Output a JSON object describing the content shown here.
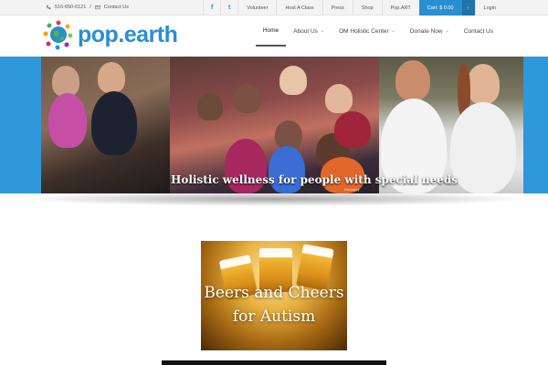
{
  "topbar": {
    "phone": "516-650-6121",
    "separator": "/",
    "contact_label": "Contact Us",
    "facebook": "f",
    "twitter": "t",
    "links": [
      "Volunteer",
      "Host A Class",
      "Press",
      "Shop",
      "Pop.ART"
    ],
    "cart_label": "Cart: $ 0.00",
    "cart_arrow": "›",
    "login_label": "Login"
  },
  "header": {
    "logo_text": "pop.earth",
    "nav": [
      {
        "label": "Home",
        "active": true
      },
      {
        "label": "About Us",
        "dropdown": true
      },
      {
        "label": "OM Holistic Center",
        "dropdown": true
      },
      {
        "label": "Donate Now",
        "dropdown": true
      },
      {
        "label": "Contact Us"
      }
    ]
  },
  "slider": {
    "caption": "Holistic wellness for people with special needs",
    "credit": "Newsday"
  },
  "promo": {
    "title_line1": "Beers and Cheers",
    "title_line2": "for Autism"
  },
  "colors": {
    "accent": "#2a8fd0",
    "banner_blue": "#2f98db"
  }
}
